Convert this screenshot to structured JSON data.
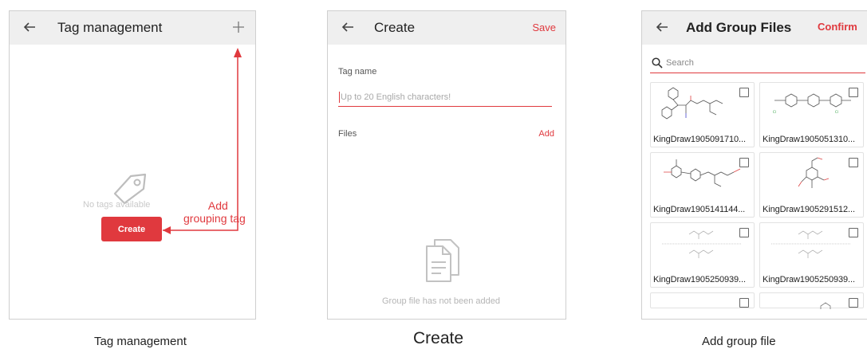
{
  "panels": {
    "tag_management": {
      "title": "Tag management",
      "empty_text": "No tags available",
      "create_label": "Create",
      "annotation_line1": "Add",
      "annotation_line2": "grouping tag",
      "caption": "Tag management"
    },
    "create": {
      "title": "Create",
      "save_label": "Save",
      "tag_name_label": "Tag name",
      "tag_name_placeholder": "Up to 20 English characters!",
      "files_label": "Files",
      "add_label": "Add",
      "empty_text": "Group file has not been added",
      "caption": "Create"
    },
    "add_group_files": {
      "title": "Add Group Files",
      "confirm_label": "Confirm",
      "search_placeholder": "Search",
      "files": [
        {
          "name": "KingDraw1905091710..."
        },
        {
          "name": "KingDraw1905051310..."
        },
        {
          "name": "KingDraw1905141144..."
        },
        {
          "name": "KingDraw1905291512..."
        },
        {
          "name": "KingDraw1905250939..."
        },
        {
          "name": "KingDraw1905250939..."
        }
      ],
      "caption": "Add group file"
    }
  },
  "colors": {
    "accent": "#e0393e",
    "header_bg": "#efefef",
    "border": "#cfcfcf"
  }
}
